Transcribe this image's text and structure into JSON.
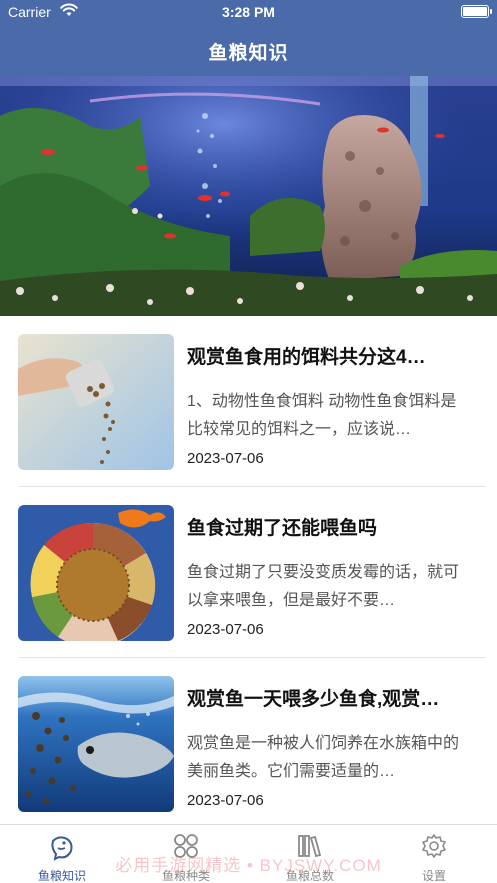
{
  "status_bar": {
    "carrier": "Carrier",
    "time": "3:28 PM"
  },
  "nav": {
    "title": "鱼粮知识"
  },
  "articles": [
    {
      "title": "观赏鱼食用的饵料共分这4…",
      "summary": "1、动物性鱼食饵料 动物性鱼食饵料是比较常见的饵料之一，应该说…",
      "date": "2023-07-06"
    },
    {
      "title": "鱼食过期了还能喂鱼吗",
      "summary": "鱼食过期了只要没变质发霉的话，就可以拿来喂鱼，但是最好不要…",
      "date": "2023-07-06"
    },
    {
      "title": "观赏鱼一天喂多少鱼食,观赏…",
      "summary": "观赏鱼是一种被人们饲养在水族箱中的美丽鱼类。它们需要适量的…",
      "date": "2023-07-06"
    }
  ],
  "tabs": [
    {
      "label": "鱼粮知识",
      "icon": "fish-icon",
      "active": true
    },
    {
      "label": "鱼粮种类",
      "icon": "grid-icon",
      "active": false
    },
    {
      "label": "鱼粮总数",
      "icon": "books-icon",
      "active": false
    },
    {
      "label": "设置",
      "icon": "gear-icon",
      "active": false
    }
  ],
  "watermark": "必用手游网精选 • BYJSWY.COM",
  "colors": {
    "accent": "#4a6aa9",
    "tab_active": "#3a5a9a",
    "tab_inactive": "#8a8a8a"
  }
}
